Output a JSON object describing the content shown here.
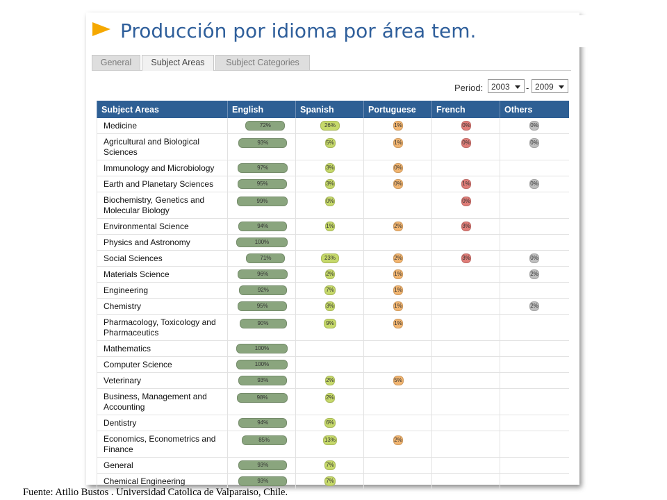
{
  "title": "Producción por idioma por área tem.",
  "tabs": [
    "General",
    "Subject Areas",
    "Subject Categories"
  ],
  "active_tab": 1,
  "period": {
    "label": "Period:",
    "from": "2003",
    "to": "2009",
    "separator": "-"
  },
  "columns": [
    "Subject Areas",
    "English",
    "Spanish",
    "Portuguese",
    "French",
    "Others"
  ],
  "colors": {
    "English": "#8aa57e",
    "Spanish": "#c6d96a",
    "Portuguese": "#f2b570",
    "French": "#e07d78",
    "Others": "#bfbfbf"
  },
  "rows": [
    {
      "name": "Medicine",
      "lines": 1,
      "values": [
        "72%",
        "26%",
        "1%",
        "0%",
        "0%"
      ]
    },
    {
      "name": "Agricultural and Biological Sciences",
      "lines": 2,
      "values": [
        "93%",
        "5%",
        "1%",
        "0%",
        "0%"
      ]
    },
    {
      "name": "Immunology and Microbiology",
      "lines": 1,
      "values": [
        "97%",
        "3%",
        "0%",
        "",
        ""
      ]
    },
    {
      "name": "Earth and Planetary Sciences",
      "lines": 1,
      "values": [
        "95%",
        "3%",
        "0%",
        "1%",
        "0%"
      ]
    },
    {
      "name": "Biochemistry, Genetics and Molecular Biology",
      "lines": 2,
      "values": [
        "99%",
        "0%",
        "",
        "0%",
        ""
      ]
    },
    {
      "name": "Environmental Science",
      "lines": 1,
      "values": [
        "94%",
        "1%",
        "2%",
        "3%",
        ""
      ]
    },
    {
      "name": "Physics and Astronomy",
      "lines": 1,
      "values": [
        "100%",
        "",
        "",
        "",
        ""
      ]
    },
    {
      "name": "Social Sciences",
      "lines": 1,
      "values": [
        "71%",
        "23%",
        "2%",
        "3%",
        "0%"
      ]
    },
    {
      "name": "Materials Science",
      "lines": 1,
      "values": [
        "96%",
        "2%",
        "1%",
        "",
        "2%"
      ]
    },
    {
      "name": "Engineering",
      "lines": 1,
      "values": [
        "92%",
        "7%",
        "1%",
        "",
        ""
      ]
    },
    {
      "name": "Chemistry",
      "lines": 1,
      "values": [
        "95%",
        "3%",
        "1%",
        "",
        "2%"
      ]
    },
    {
      "name": "Pharmacology, Toxicology and Pharmaceutics",
      "lines": 2,
      "values": [
        "90%",
        "9%",
        "1%",
        "",
        ""
      ]
    },
    {
      "name": "Mathematics",
      "lines": 1,
      "values": [
        "100%",
        "",
        "",
        "",
        ""
      ]
    },
    {
      "name": "Computer Science",
      "lines": 1,
      "values": [
        "100%",
        "",
        "",
        "",
        ""
      ]
    },
    {
      "name": "Veterinary",
      "lines": 1,
      "values": [
        "93%",
        "2%",
        "5%",
        "",
        ""
      ]
    },
    {
      "name": "Business, Management and Accounting",
      "lines": 2,
      "values": [
        "98%",
        "2%",
        "",
        "",
        ""
      ]
    },
    {
      "name": "Dentistry",
      "lines": 1,
      "values": [
        "94%",
        "6%",
        "",
        "",
        ""
      ]
    },
    {
      "name": "Economics, Econometrics and Finance",
      "lines": 2,
      "values": [
        "85%",
        "13%",
        "2%",
        "",
        ""
      ]
    },
    {
      "name": "General",
      "lines": 1,
      "values": [
        "93%",
        "7%",
        "",
        "",
        ""
      ]
    },
    {
      "name": "Chemical Engineering",
      "lines": 1,
      "values": [
        "93%",
        "7%",
        "",
        "",
        ""
      ]
    }
  ],
  "footer": "Fuente: Atilio Bustos . Universidad Catolica de Valparaiso, Chile."
}
